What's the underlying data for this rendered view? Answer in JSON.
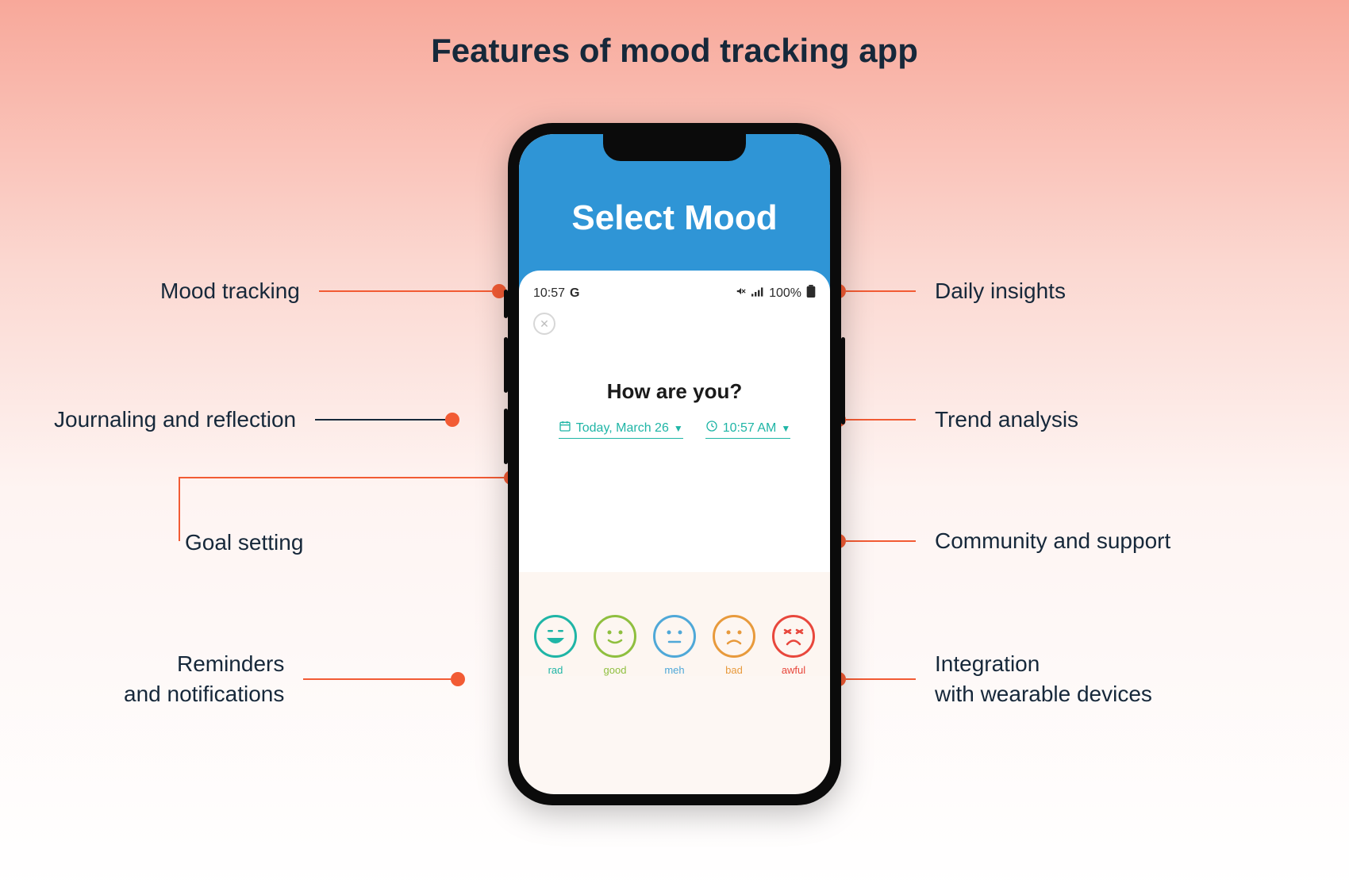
{
  "title": "Features of mood tracking app",
  "features_left": [
    "Mood tracking",
    "Journaling and reflection",
    "Goal setting",
    "Reminders\nand notifications"
  ],
  "features_right": [
    "Daily insights",
    "Trend analysis",
    "Community and support",
    "Integration\nwith wearable devices"
  ],
  "app": {
    "header_title": "Select Mood",
    "status_time": "10:57",
    "status_brand": "G",
    "status_battery": "100%",
    "prompt": "How are you?",
    "date_picker": "Today, March 26",
    "time_picker": "10:57 AM",
    "moods": [
      {
        "label": "rad",
        "color": "#1fb5a6"
      },
      {
        "label": "good",
        "color": "#8fbf3f"
      },
      {
        "label": "meh",
        "color": "#4fa8d8"
      },
      {
        "label": "bad",
        "color": "#e89a3c"
      },
      {
        "label": "awful",
        "color": "#e8473c"
      }
    ]
  }
}
